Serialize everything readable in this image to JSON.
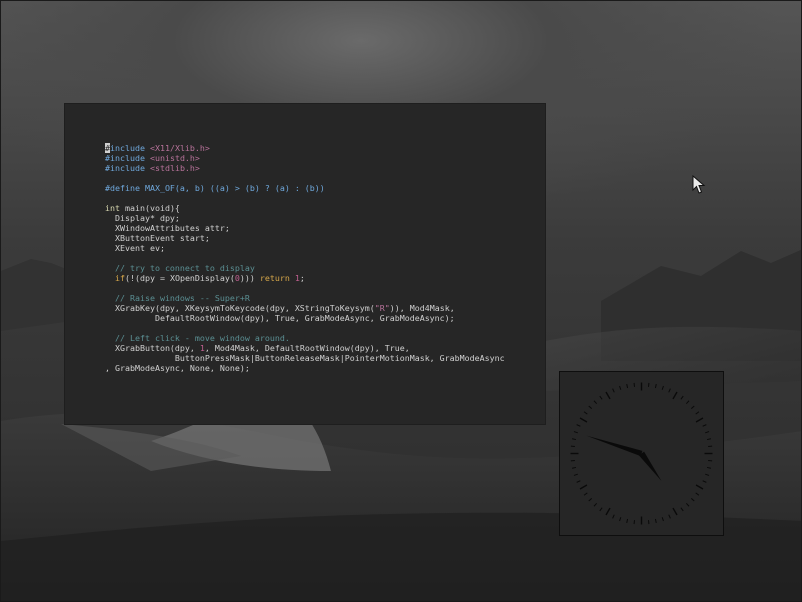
{
  "terminal": {
    "lines": [
      [
        {
          "t": "#",
          "c": "cursor"
        },
        {
          "t": "include ",
          "c": "pp"
        },
        {
          "t": "<X11/Xlib.h>",
          "c": "str"
        }
      ],
      [
        {
          "t": "#include ",
          "c": "pp"
        },
        {
          "t": "<unistd.h>",
          "c": "str"
        }
      ],
      [
        {
          "t": "#include ",
          "c": "pp"
        },
        {
          "t": "<stdlib.h>",
          "c": "str"
        }
      ],
      [],
      [
        {
          "t": "#define MAX_OF(a, b) ((a) > (b) ? (a) : (b))",
          "c": "pp"
        }
      ],
      [],
      [
        {
          "t": "int ",
          "c": "ty"
        },
        {
          "t": "main(void){"
        }
      ],
      [
        {
          "t": "  Display* dpy;"
        }
      ],
      [
        {
          "t": "  XWindowAttributes attr;"
        }
      ],
      [
        {
          "t": "  XButtonEvent start;"
        }
      ],
      [
        {
          "t": "  XEvent ev;"
        }
      ],
      [],
      [
        {
          "t": "  // try to connect to display",
          "c": "cm"
        }
      ],
      [
        {
          "t": "  "
        },
        {
          "t": "if",
          "c": "kw"
        },
        {
          "t": "(!(dpy = XOpenDisplay("
        },
        {
          "t": "0",
          "c": "num"
        },
        {
          "t": "))) "
        },
        {
          "t": "return ",
          "c": "kw"
        },
        {
          "t": "1",
          "c": "num"
        },
        {
          "t": ";"
        }
      ],
      [],
      [
        {
          "t": "  // Raise windows -- Super+R",
          "c": "cm"
        }
      ],
      [
        {
          "t": "  XGrabKey(dpy, XKeysymToKeycode(dpy, XStringToKeysym("
        },
        {
          "t": "\"R\"",
          "c": "str"
        },
        {
          "t": ")), Mod4Mask,"
        }
      ],
      [
        {
          "t": "          DefaultRootWindow(dpy), True, GrabModeAsync, GrabModeAsync);"
        }
      ],
      [],
      [
        {
          "t": "  // Left click - move window around.",
          "c": "cm"
        }
      ],
      [
        {
          "t": "  XGrabButton(dpy, "
        },
        {
          "t": "1",
          "c": "num"
        },
        {
          "t": ", Mod4Mask, DefaultRootWindow(dpy), True,"
        }
      ],
      [
        {
          "t": "              ButtonPressMask|ButtonReleaseMask|PointerMotionMask, GrabModeAsync"
        }
      ],
      [
        {
          "t": ", GrabModeAsync, None, None);"
        }
      ]
    ]
  },
  "clock": {
    "hour": 4,
    "minute": 48
  },
  "desktop": {
    "icons": {
      "pointer": "mouse-pointer-icon"
    },
    "colors": {
      "terminal_bg": "#262626",
      "comment": "#5b8f93",
      "keyword": "#d6a74a",
      "preprocessor": "#6fa8dc",
      "string": "#b8739b"
    }
  }
}
